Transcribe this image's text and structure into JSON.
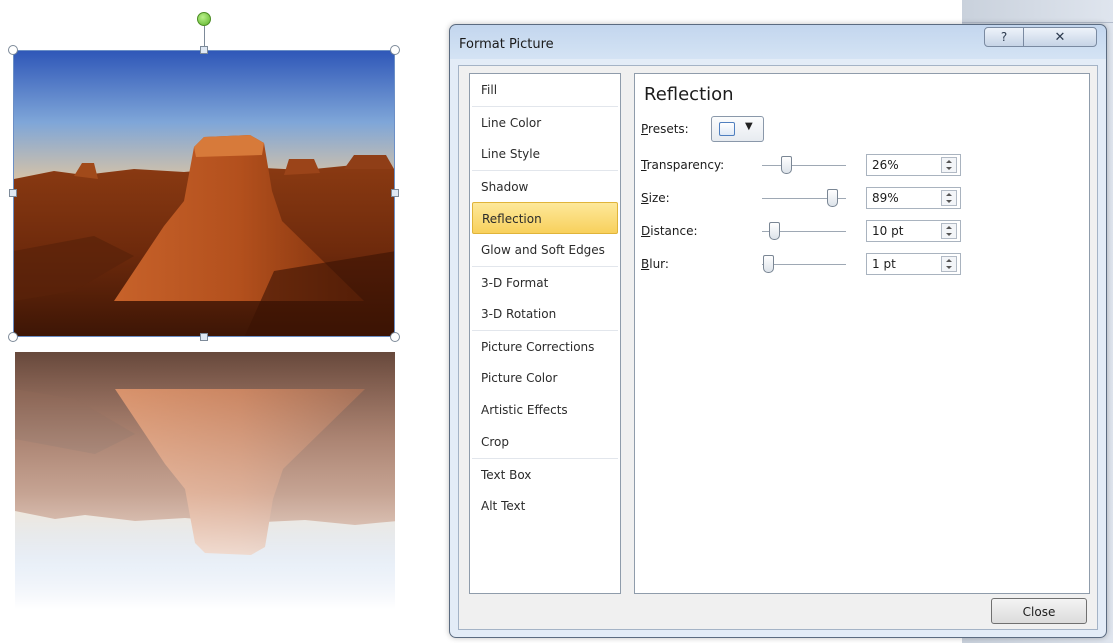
{
  "dialog": {
    "title": "Format Picture",
    "help_button": "?",
    "close_x_button": "✕",
    "close_button_label": "Close"
  },
  "categories": [
    {
      "label": "Fill"
    },
    {
      "label": "Line Color"
    },
    {
      "label": "Line Style"
    },
    {
      "label": "Shadow"
    },
    {
      "label": "Reflection",
      "selected": true
    },
    {
      "label": "Glow and Soft Edges"
    },
    {
      "label": "3-D Format"
    },
    {
      "label": "3-D Rotation"
    },
    {
      "label": "Picture Corrections"
    },
    {
      "label": "Picture Color"
    },
    {
      "label": "Artistic Effects"
    },
    {
      "label": "Crop"
    },
    {
      "label": "Text Box"
    },
    {
      "label": "Alt Text"
    }
  ],
  "panel": {
    "title": "Reflection",
    "presets_label_rest": "resets:",
    "presets_label_key": "P",
    "preset_icon": "reflection-preset-icon",
    "rows": [
      {
        "key": "T",
        "rest": "ransparency:",
        "value": "26%",
        "level": 0.26
      },
      {
        "key": "S",
        "rest": "ize:",
        "value": "89%",
        "level": 0.89
      },
      {
        "key": "D",
        "rest": "istance:",
        "value": "10 pt",
        "level": 0.1
      },
      {
        "key": "B",
        "rest": "lur:",
        "value": "1 pt",
        "level": 0.01
      }
    ]
  },
  "colors": {
    "selected_item": "#f8d05c",
    "title_gradient_top": "#c3d6ee",
    "accent_border": "#6b8fc6"
  }
}
